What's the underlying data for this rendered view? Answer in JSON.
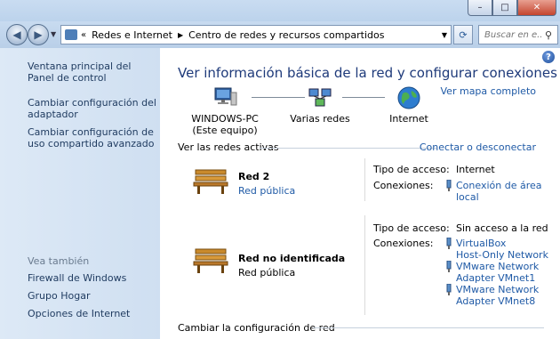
{
  "window": {
    "buttons": {
      "minimize": "–",
      "maximize": "□",
      "close": "✕"
    }
  },
  "nav": {
    "back_icon": "back-arrow-icon",
    "forward_icon": "forward-arrow-icon",
    "breadcrumb": [
      "Redes e Internet",
      "Centro de redes y recursos compartidos"
    ],
    "search_placeholder": "Buscar en e..."
  },
  "sidebar": {
    "links": [
      "Ventana principal del Panel de control",
      "Cambiar configuración del adaptador",
      "Cambiar configuración de uso compartido avanzado"
    ],
    "see_also_heading": "Vea también",
    "see_also": [
      "Firewall de Windows",
      "Grupo Hogar",
      "Opciones de Internet"
    ]
  },
  "main": {
    "title": "Ver información básica de la red y configurar conexiones",
    "map_link": "Ver mapa completo",
    "nodes": [
      {
        "label": "WINDOWS-PC",
        "sublabel": "(Este equipo)"
      },
      {
        "label": "Varias redes",
        "sublabel": ""
      },
      {
        "label": "Internet",
        "sublabel": ""
      }
    ],
    "active_networks_label": "Ver las redes activas",
    "connect_link": "Conectar o desconectar",
    "networks": [
      {
        "name": "Red  2",
        "type": "Red pública",
        "type_is_link": true,
        "access_label": "Tipo de acceso:",
        "access": "Internet",
        "connections_label": "Conexiones:",
        "connections": [
          [
            "Conexión de área",
            "local"
          ]
        ]
      },
      {
        "name": "Red no identificada",
        "type": "Red pública",
        "type_is_link": false,
        "access_label": "Tipo de acceso:",
        "access": "Sin acceso a la red",
        "connections_label": "Conexiones:",
        "connections": [
          [
            "VirtualBox",
            "Host-Only Network"
          ],
          [
            "VMware Network",
            "Adapter VMnet1"
          ],
          [
            "VMware Network",
            "Adapter VMnet8"
          ]
        ]
      }
    ],
    "footer_label": "Cambiar la configuración de red"
  },
  "colors": {
    "link": "#1f5aa6",
    "title": "#1e3a7a",
    "sidebar_bg": "#d6e5f5"
  }
}
